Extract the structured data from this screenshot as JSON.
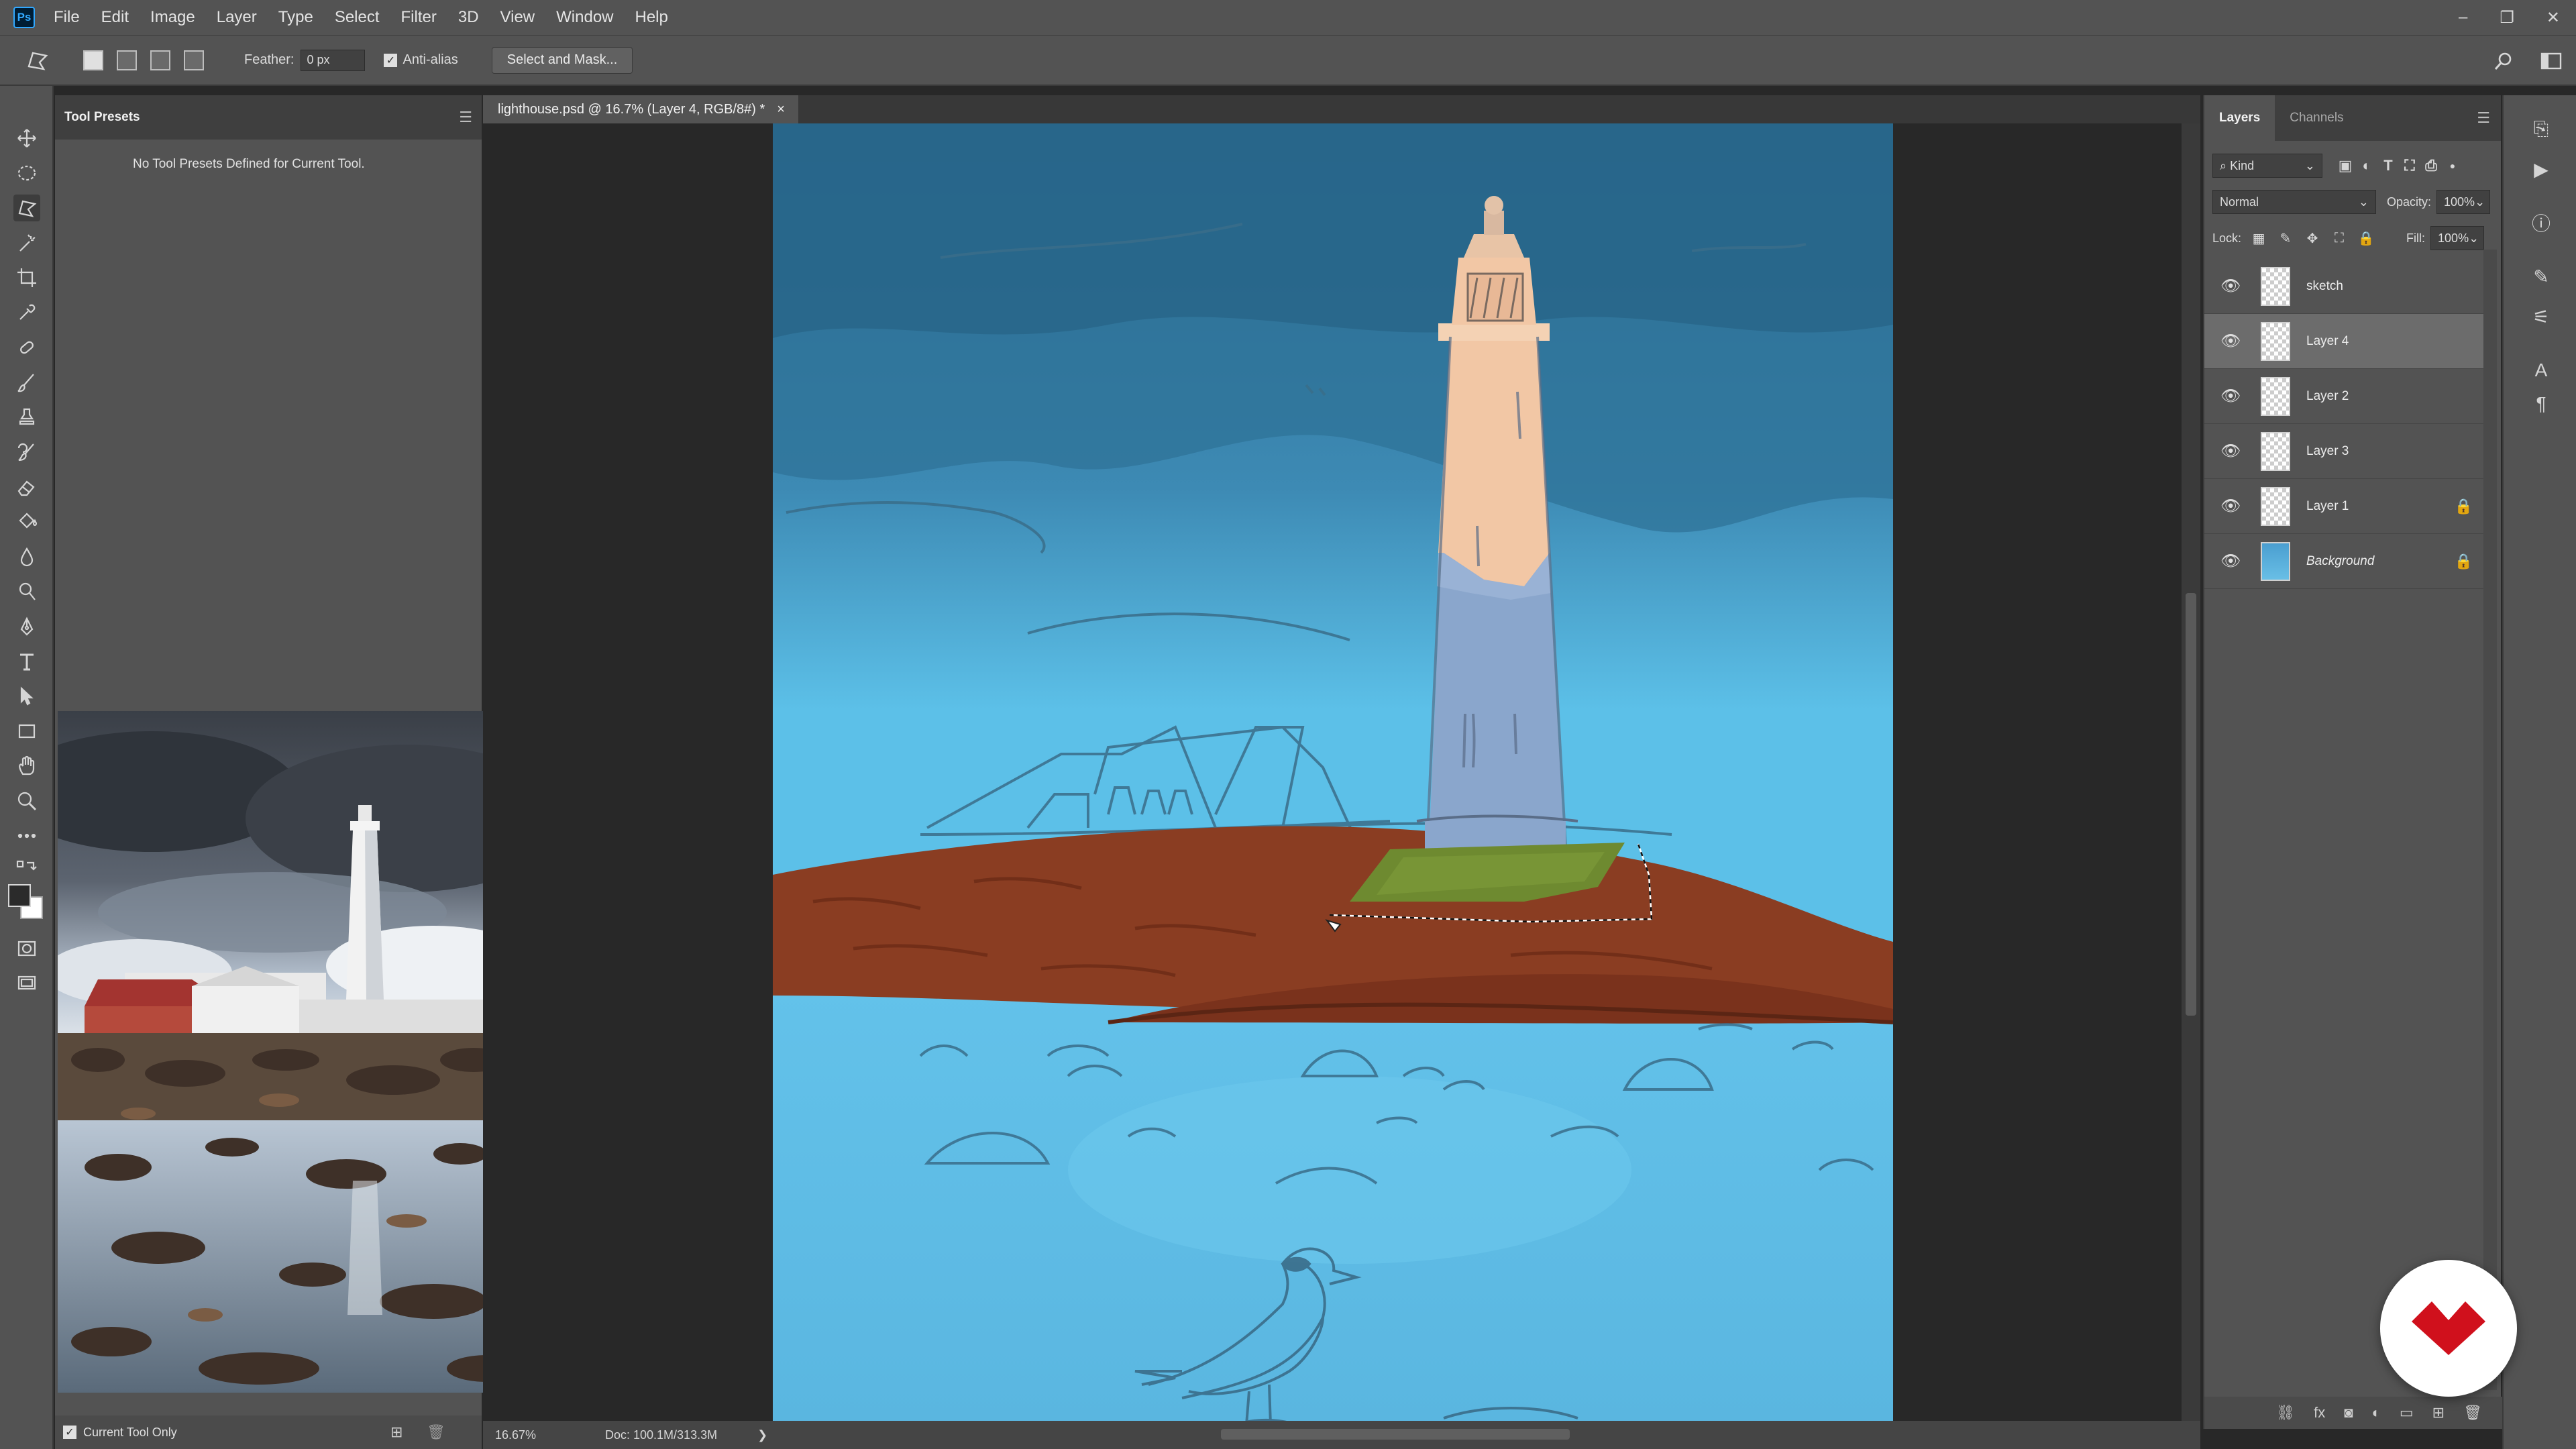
{
  "app": {
    "logo": "Ps"
  },
  "menu": [
    "File",
    "Edit",
    "Image",
    "Layer",
    "Type",
    "Select",
    "Filter",
    "3D",
    "View",
    "Window",
    "Help"
  ],
  "window_controls": {
    "minimize": "–",
    "restore": "❐",
    "close": "✕"
  },
  "options": {
    "feather_label": "Feather:",
    "feather_value": "0 px",
    "antialias_label": "Anti-alias",
    "antialias_checked": true,
    "select_mask_label": "Select and Mask..."
  },
  "tool_presets": {
    "tab": "Tool Presets",
    "empty_message": "No Tool Presets Defined for Current Tool.",
    "current_tool_only": "Current Tool Only"
  },
  "document": {
    "tab_title": "lighthouse.psd @ 16.7% (Layer 4, RGB/8#) *",
    "close": "×"
  },
  "status": {
    "zoom": "16.67%",
    "doc_size": "Doc: 100.1M/313.3M",
    "arrow": "❯"
  },
  "layers_panel": {
    "tabs": [
      "Layers",
      "Channels"
    ],
    "filter_kind": "Kind",
    "blend_mode": "Normal",
    "opacity_label": "Opacity:",
    "opacity_value": "100%",
    "lock_label": "Lock:",
    "fill_label": "Fill:",
    "fill_value": "100%",
    "layers": [
      {
        "name": "sketch",
        "visible": true,
        "selected": false,
        "locked": false
      },
      {
        "name": "Layer 4",
        "visible": true,
        "selected": true,
        "locked": false
      },
      {
        "name": "Layer 2",
        "visible": true,
        "selected": false,
        "locked": false
      },
      {
        "name": "Layer 3",
        "visible": true,
        "selected": false,
        "locked": false
      },
      {
        "name": "Layer 1",
        "visible": true,
        "selected": false,
        "locked": true
      },
      {
        "name": "Background",
        "visible": true,
        "selected": false,
        "locked": true
      }
    ]
  },
  "colors": {
    "sky_top": "#2c6d92",
    "sky_bottom": "#5cc0e8",
    "rock": "#8a3d22",
    "lighthouse_lit": "#f2c7a5",
    "lighthouse_shade": "#8aa6cc",
    "grass": "#6e8a30",
    "brand_red": "#d0101c"
  }
}
